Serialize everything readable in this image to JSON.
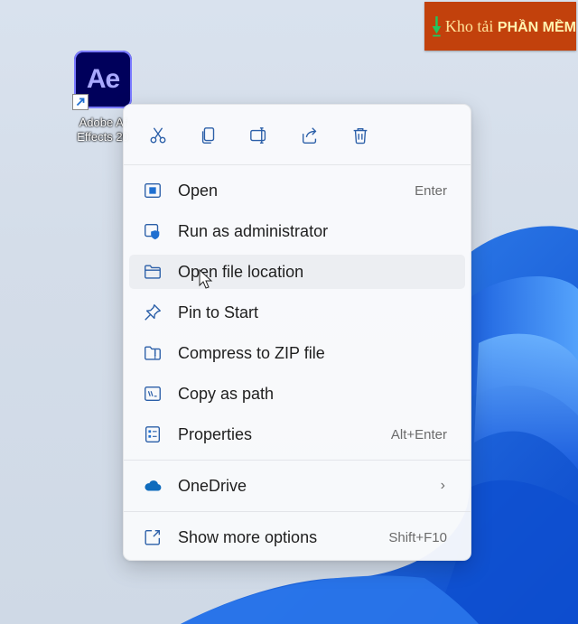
{
  "colors": {
    "accent": "#0067c0",
    "menu_bg": "#f9fafc",
    "hover_bg": "#eceef2",
    "brand_bg": "#c2410c"
  },
  "watermark": {
    "prefix": "Kho tải ",
    "highlight": "PHẦN MỀM"
  },
  "desktop_icon": {
    "tile_text": "Ae",
    "label_line1": "Adobe Af",
    "label_line2": "Effects 20"
  },
  "context_menu": {
    "quick_actions": [
      {
        "icon": "cut-icon"
      },
      {
        "icon": "copy-icon"
      },
      {
        "icon": "rename-icon"
      },
      {
        "icon": "share-icon"
      },
      {
        "icon": "delete-icon"
      }
    ],
    "items": [
      {
        "icon": "open-icon",
        "label": "Open",
        "accel": "Enter"
      },
      {
        "icon": "shield-icon",
        "label": "Run as administrator",
        "accel": ""
      },
      {
        "icon": "folder-icon",
        "label": "Open file location",
        "accel": "",
        "hovered": true
      },
      {
        "icon": "pin-icon",
        "label": "Pin to Start",
        "accel": ""
      },
      {
        "icon": "zip-icon",
        "label": "Compress to ZIP file",
        "accel": ""
      },
      {
        "icon": "copy-path-icon",
        "label": "Copy as path",
        "accel": ""
      },
      {
        "icon": "properties-icon",
        "label": "Properties",
        "accel": "Alt+Enter"
      }
    ],
    "onedrive": {
      "icon": "cloud-icon",
      "label": "OneDrive",
      "chevron": "›"
    },
    "more": {
      "icon": "show-more-icon",
      "label": "Show more options",
      "accel": "Shift+F10"
    }
  }
}
